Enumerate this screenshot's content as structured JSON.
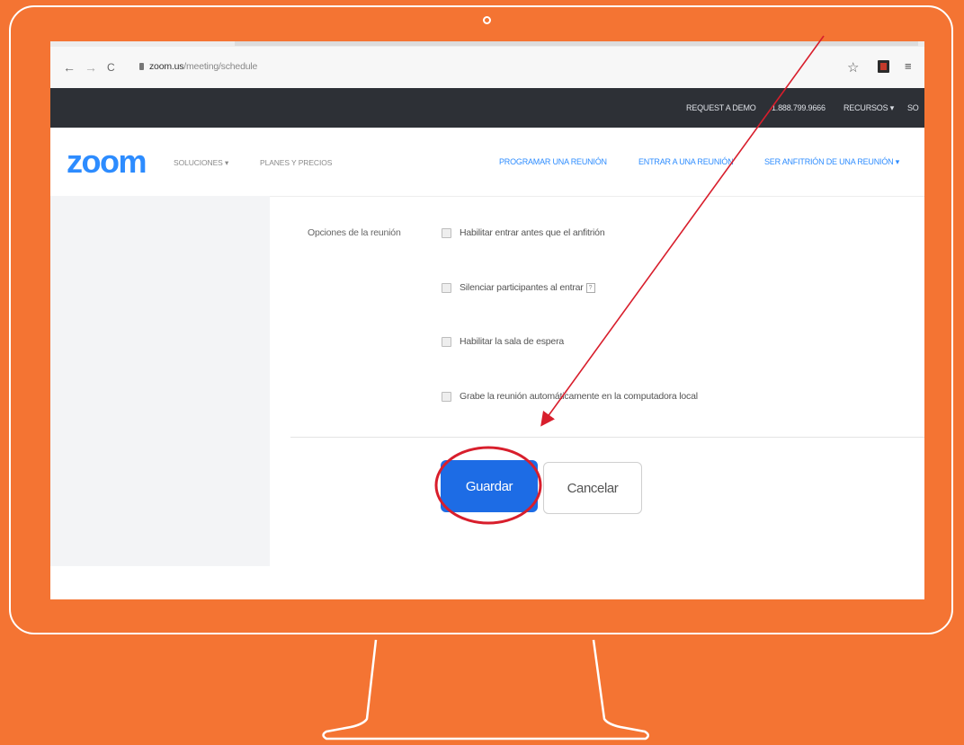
{
  "browser": {
    "back_icon": "←",
    "forward_icon": "→",
    "reload_icon": "C",
    "url_domain": "zoom.us",
    "url_path": "/meeting/schedule",
    "bookmark_icon": "☆",
    "menu_icon": "≡"
  },
  "topbar": {
    "request_demo": "REQUEST A DEMO",
    "phone": "1.888.799.9666",
    "resources": "RECURSOS ▾",
    "support": "SO"
  },
  "nav": {
    "logo": "zoom",
    "solutions": "SOLUCIONES ▾",
    "plans": "PLANES Y PRECIOS",
    "schedule": "PROGRAMAR UNA REUNIÓN",
    "join": "ENTRAR A UNA REUNIÓN",
    "host": "SER ANFITRIÓN DE UNA REUNIÓN ▾"
  },
  "options": {
    "label": "Opciones de la reunión",
    "items": [
      {
        "label": "Habilitar entrar antes que el anfitrión",
        "checked": false
      },
      {
        "label": "Silenciar participantes al entrar",
        "checked": false
      },
      {
        "label": "Habilitar la sala de espera",
        "checked": false
      },
      {
        "label": "Grabe la reunión automáticamente en la computadora local",
        "checked": false
      }
    ]
  },
  "actions": {
    "save_label": "Guardar",
    "cancel_label": "Cancelar"
  },
  "colors": {
    "background": "#F47433",
    "zoom_blue": "#2D8CFF",
    "save_button": "#1D6CE5",
    "annotation": "#D81E2C"
  }
}
